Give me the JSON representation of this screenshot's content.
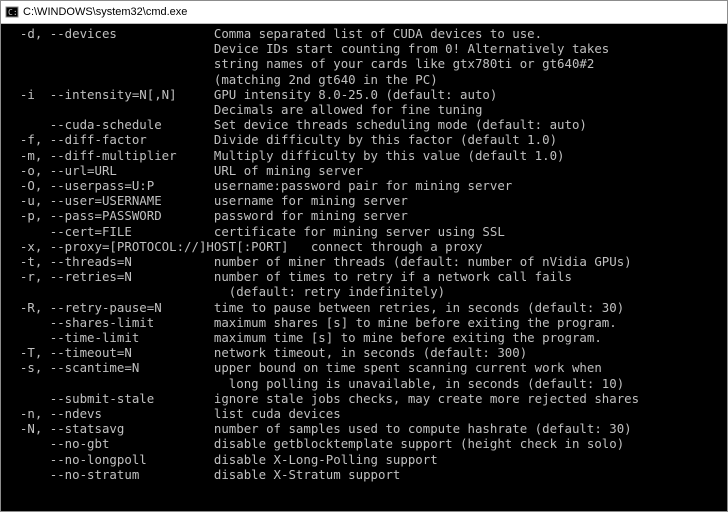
{
  "titlebar": {
    "path": "C:\\WINDOWS\\system32\\cmd.exe"
  },
  "options": [
    {
      "flags": "-d, --devices",
      "desc": "Comma separated list of CUDA devices to use."
    },
    {
      "flags": "",
      "desc": "Device IDs start counting from 0! Alternatively takes"
    },
    {
      "flags": "",
      "desc": "string names of your cards like gtx780ti or gt640#2"
    },
    {
      "flags": "",
      "desc": "(matching 2nd gt640 in the PC)"
    },
    {
      "flags": "-i  --intensity=N[,N]",
      "desc": "GPU intensity 8.0-25.0 (default: auto)"
    },
    {
      "flags": "",
      "desc": "Decimals are allowed for fine tuning"
    },
    {
      "flags": "    --cuda-schedule",
      "desc": "Set device threads scheduling mode (default: auto)"
    },
    {
      "flags": "-f, --diff-factor",
      "desc": "Divide difficulty by this factor (default 1.0)"
    },
    {
      "flags": "-m, --diff-multiplier",
      "desc": "Multiply difficulty by this value (default 1.0)"
    },
    {
      "flags": "-o, --url=URL",
      "desc": "URL of mining server"
    },
    {
      "flags": "-O, --userpass=U:P",
      "desc": "username:password pair for mining server"
    },
    {
      "flags": "-u, --user=USERNAME",
      "desc": "username for mining server"
    },
    {
      "flags": "-p, --pass=PASSWORD",
      "desc": "password for mining server"
    },
    {
      "flags": "    --cert=FILE",
      "desc": "certificate for mining server using SSL"
    },
    {
      "flags": "-x, --proxy=[PROTOCOL://]HOST[:PORT]   connect through a proxy",
      "desc": null
    },
    {
      "flags": "-t, --threads=N",
      "desc": "number of miner threads (default: number of nVidia GPUs)"
    },
    {
      "flags": "-r, --retries=N",
      "desc": "number of times to retry if a network call fails"
    },
    {
      "flags": "",
      "desc": "  (default: retry indefinitely)"
    },
    {
      "flags": "-R, --retry-pause=N",
      "desc": "time to pause between retries, in seconds (default: 30)"
    },
    {
      "flags": "    --shares-limit",
      "desc": "maximum shares [s] to mine before exiting the program."
    },
    {
      "flags": "    --time-limit",
      "desc": "maximum time [s] to mine before exiting the program."
    },
    {
      "flags": "-T, --timeout=N",
      "desc": "network timeout, in seconds (default: 300)"
    },
    {
      "flags": "-s, --scantime=N",
      "desc": "upper bound on time spent scanning current work when"
    },
    {
      "flags": "",
      "desc": "  long polling is unavailable, in seconds (default: 10)"
    },
    {
      "flags": "    --submit-stale",
      "desc": "ignore stale jobs checks, may create more rejected shares"
    },
    {
      "flags": "-n, --ndevs",
      "desc": "list cuda devices"
    },
    {
      "flags": "-N, --statsavg",
      "desc": "number of samples used to compute hashrate (default: 30)"
    },
    {
      "flags": "    --no-gbt",
      "desc": "disable getblocktemplate support (height check in solo)"
    },
    {
      "flags": "    --no-longpoll",
      "desc": "disable X-Long-Polling support"
    },
    {
      "flags": "    --no-stratum",
      "desc": "disable X-Stratum support"
    }
  ],
  "layout": {
    "indent": "  ",
    "desc_col": 28
  }
}
